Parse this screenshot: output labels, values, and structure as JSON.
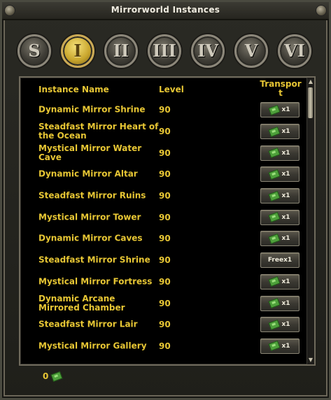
{
  "window": {
    "title": "Mirrorworld Instances"
  },
  "tabs": [
    {
      "label": "S",
      "active": false
    },
    {
      "label": "I",
      "active": true
    },
    {
      "label": "II",
      "active": false
    },
    {
      "label": "III",
      "active": false
    },
    {
      "label": "IV",
      "active": false
    },
    {
      "label": "V",
      "active": false
    },
    {
      "label": "VI",
      "active": false
    }
  ],
  "table": {
    "headers": {
      "name": "Instance Name",
      "level": "Level",
      "transport": "Transpor t"
    },
    "rows": [
      {
        "name": "Dynamic Mirror Shrine",
        "level": "90",
        "transport": "x1",
        "icon": "ticket-icon"
      },
      {
        "name": "Steadfast Mirror Heart of the Ocean",
        "level": "90",
        "transport": "x1",
        "icon": "ticket-icon"
      },
      {
        "name": "Mystical Mirror Water Cave",
        "level": "90",
        "transport": "x1",
        "icon": "ticket-icon"
      },
      {
        "name": "Dynamic Mirror Altar",
        "level": "90",
        "transport": "x1",
        "icon": "ticket-icon"
      },
      {
        "name": "Steadfast Mirror Ruins",
        "level": "90",
        "transport": "x1",
        "icon": "ticket-icon"
      },
      {
        "name": "Mystical Mirror Tower",
        "level": "90",
        "transport": "x1",
        "icon": "ticket-icon"
      },
      {
        "name": "Dynamic Mirror Caves",
        "level": "90",
        "transport": "x1",
        "icon": "ticket-icon"
      },
      {
        "name": "Steadfast Mirror Shrine",
        "level": "90",
        "transport": "Freex1",
        "icon": ""
      },
      {
        "name": "Mystical Mirror Fortress",
        "level": "90",
        "transport": "x1",
        "icon": "ticket-icon"
      },
      {
        "name": "Dynamic Arcane Mirrored Chamber",
        "level": "90",
        "transport": "x1",
        "icon": "ticket-icon"
      },
      {
        "name": "Steadfast Mirror Lair",
        "level": "90",
        "transport": "x1",
        "icon": "ticket-icon"
      },
      {
        "name": "Mystical Mirror Gallery",
        "level": "90",
        "transport": "x1",
        "icon": "ticket-icon"
      }
    ]
  },
  "footer": {
    "ticket_count": "0",
    "icon": "ticket-icon"
  },
  "colors": {
    "text_gold": "#e7c634",
    "tab_active": "#c8a52c",
    "ticket_green": "#4ea03b"
  }
}
